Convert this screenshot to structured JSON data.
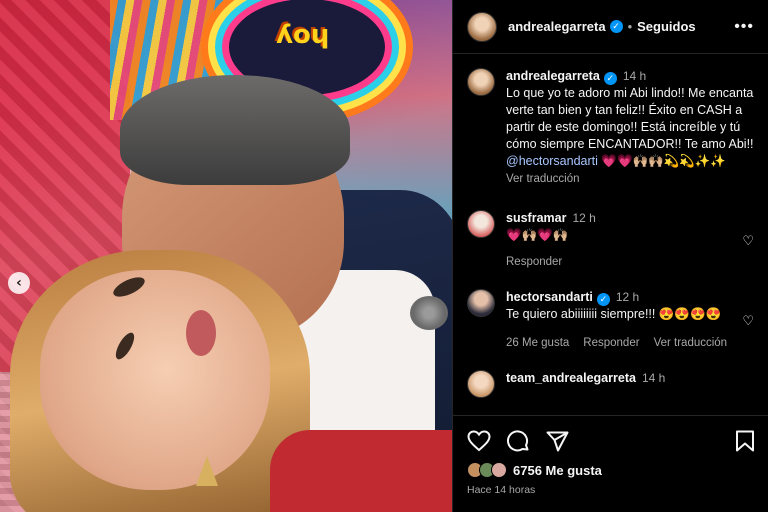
{
  "post": {
    "username": "andrealegarreta",
    "follow_state": "Seguidos",
    "caption": {
      "time": "14 h",
      "text": "Lo que yo te adoro mi Abi lindo!! Me encanta verte tan bien y tan feliz!! Éxito en CASH a partir de este domingo!! Está increíble y tú cómo siempre ENCANTADOR!! Te amo Abi!!",
      "mention": "@hectorsandarti",
      "emojis": "💗💗🙌🏼🙌🏼💫💫✨✨",
      "translate": "Ver traducción"
    }
  },
  "comments": [
    {
      "username": "susframar",
      "time": "12 h",
      "text": "💗🙌🏼💗🙌🏼",
      "reply": "Responder"
    },
    {
      "username": "hectorsandarti",
      "time": "12 h",
      "text": "Te quiero abiiiiiiii siempre!!! 😍😍😍😍",
      "likes": "26 Me gusta",
      "reply": "Responder",
      "translate": "Ver traducción"
    },
    {
      "username": "team_andrealegarreta",
      "time": "14 h"
    }
  ],
  "footer": {
    "likes": "6756 Me gusta",
    "time_ago": "Hace 14 horas"
  },
  "image": {
    "logo_text": "hoy",
    "arrow": "‹"
  }
}
